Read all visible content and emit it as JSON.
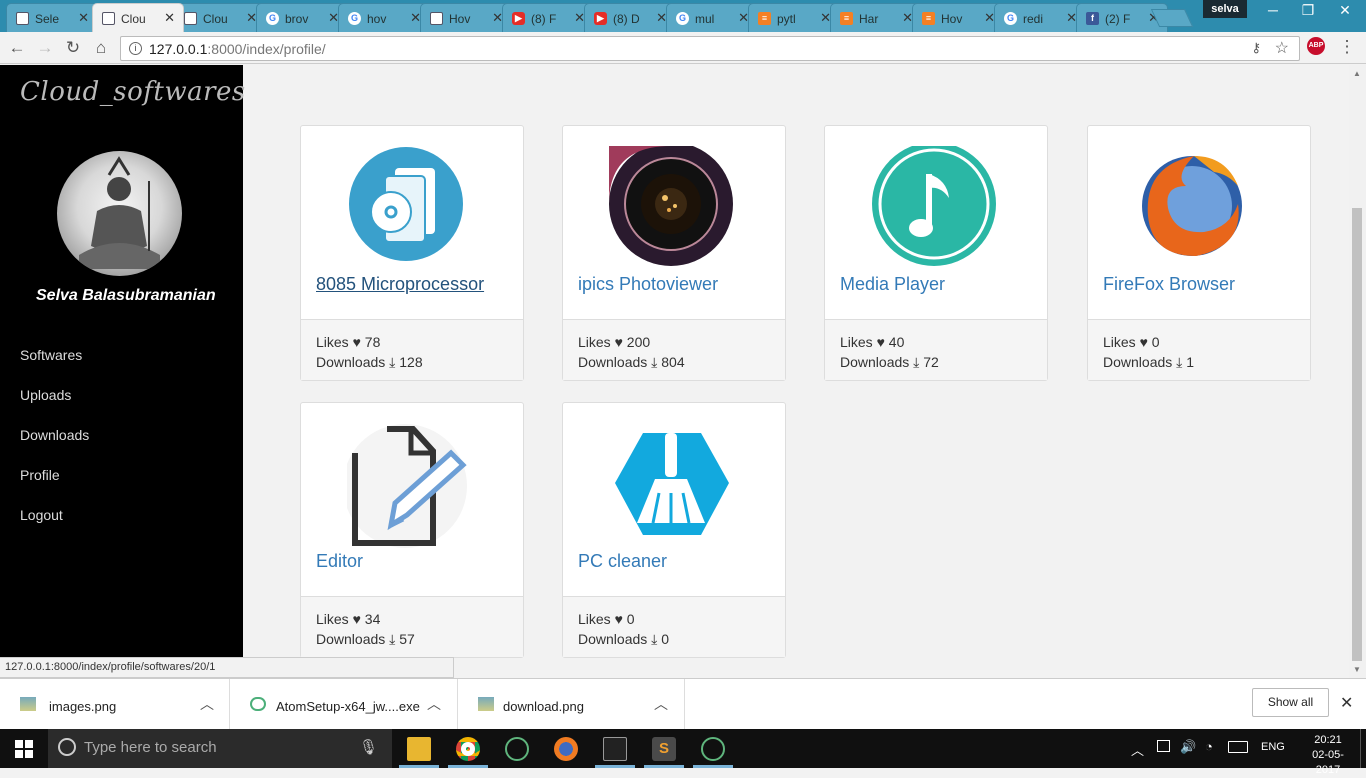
{
  "browser": {
    "tabs": [
      {
        "label": "Sele",
        "icon": "doc"
      },
      {
        "label": "Clou",
        "icon": "doc",
        "active": true
      },
      {
        "label": "Clou",
        "icon": "doc"
      },
      {
        "label": "brov",
        "icon": "google"
      },
      {
        "label": "hov",
        "icon": "google"
      },
      {
        "label": "Hov",
        "icon": "doc"
      },
      {
        "label": "(8) F",
        "icon": "youtube"
      },
      {
        "label": "(8) D",
        "icon": "youtube"
      },
      {
        "label": "mul",
        "icon": "google"
      },
      {
        "label": "pytl",
        "icon": "stackoverflow"
      },
      {
        "label": "Har",
        "icon": "stackoverflow"
      },
      {
        "label": "Hov",
        "icon": "stackoverflow"
      },
      {
        "label": "redi",
        "icon": "google"
      },
      {
        "label": "(2) F",
        "icon": "facebook"
      }
    ],
    "user_chip": "selva",
    "url_host": "127.0.0.1",
    "url_path": ":8000/index/profile/",
    "status_url": "127.0.0.1:8000/index/profile/softwares/20/1"
  },
  "sidebar": {
    "brand": "Cloud_softwares",
    "username": "Selva Balasubramanian",
    "links": [
      "Softwares",
      "Uploads",
      "Downloads",
      "Profile",
      "Logout"
    ]
  },
  "cards": [
    {
      "title": "8085 Microprocessor",
      "likes_label": "Likes",
      "likes": "78",
      "downloads_label": "Downloads",
      "downloads": "128",
      "icon": "cd-box-icon"
    },
    {
      "title": "ipics Photoviewer",
      "likes_label": "Likes",
      "likes": "200",
      "downloads_label": "Downloads",
      "downloads": "804",
      "icon": "camera-lens-icon"
    },
    {
      "title": "Media Player",
      "likes_label": "Likes",
      "likes": "40",
      "downloads_label": "Downloads",
      "downloads": "72",
      "icon": "music-note-icon"
    },
    {
      "title": "FireFox Browser",
      "likes_label": "Likes",
      "likes": "0",
      "downloads_label": "Downloads",
      "downloads": "1",
      "icon": "firefox-icon"
    },
    {
      "title": "Editor",
      "likes_label": "Likes",
      "likes": "34",
      "downloads_label": "Downloads",
      "downloads": "57",
      "icon": "document-pencil-icon"
    },
    {
      "title": "PC cleaner",
      "likes_label": "Likes",
      "likes": "0",
      "downloads_label": "Downloads",
      "downloads": "0",
      "icon": "broom-icon"
    }
  ],
  "downloads_bar": {
    "items": [
      "images.png",
      "AtomSetup-x64_jw....exe",
      "download.png"
    ],
    "show_all": "Show all"
  },
  "taskbar": {
    "search_placeholder": "Type here to search",
    "lang": "ENG",
    "time": "20:21",
    "date": "02-05-2017"
  },
  "colors": {
    "link": "#337ab7",
    "tabbar": "#2d8cae",
    "sidebar": "#000000"
  }
}
